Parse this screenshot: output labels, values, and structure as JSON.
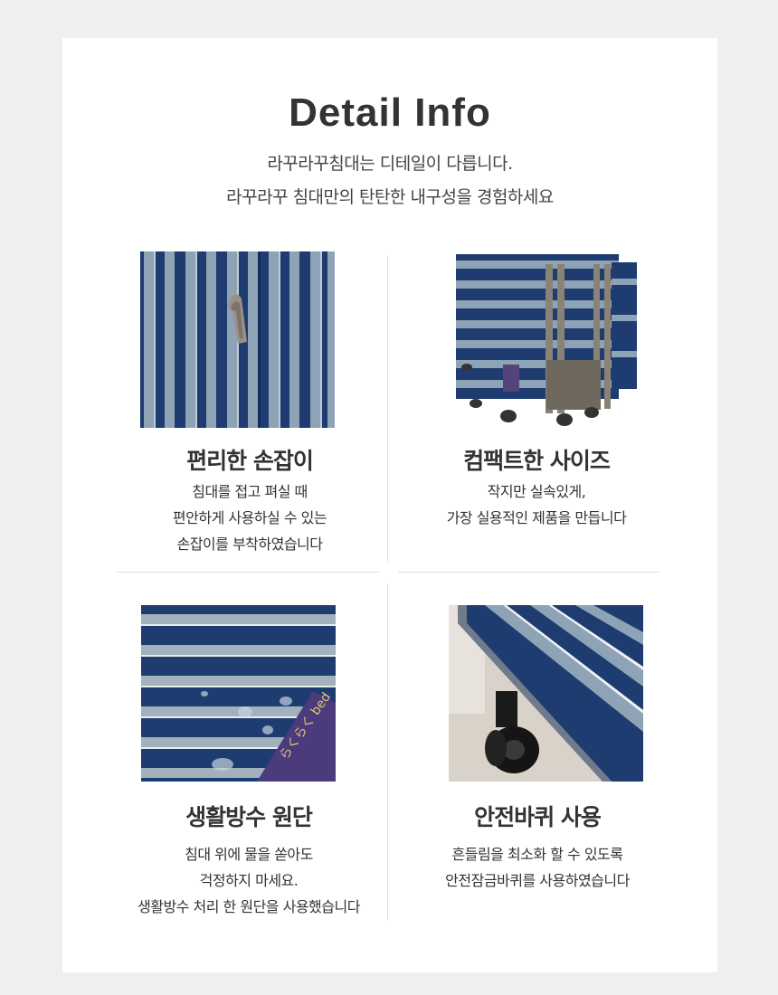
{
  "header": {
    "title": "Detail Info",
    "subtitle_line1": "라꾸라꾸침대는 디테일이 다릅니다.",
    "subtitle_line2": "라꾸라꾸 침대만의 탄탄한 내구성을 경험하세요"
  },
  "features": [
    {
      "title": "편리한 손잡이",
      "lines": [
        "침대를 접고 펴실 때",
        "편안하게 사용하실 수 있는",
        "손잡이를 부착하였습니다"
      ]
    },
    {
      "title": "컴팩트한 사이즈",
      "lines": [
        "작지만 실속있게,",
        "가장 실용적인 제품을 만듭니다"
      ]
    },
    {
      "title": "생활방수 원단",
      "lines": [
        "침대 위에 물을 쏟아도",
        "걱정하지 마세요.",
        "생활방수 처리 한 원단을 사용했습니다"
      ]
    },
    {
      "title": "안전바퀴 사용",
      "lines": [
        "흔들림을 최소화 할 수 있도록",
        "안전잠금바퀴를 사용하였습니다"
      ]
    }
  ],
  "brand_tag": "らくらく bed",
  "colors": {
    "background": "#efefef",
    "card": "#ffffff",
    "navy_stripe": "#1d3a6e",
    "light_stripe": "#8fa2b4"
  }
}
